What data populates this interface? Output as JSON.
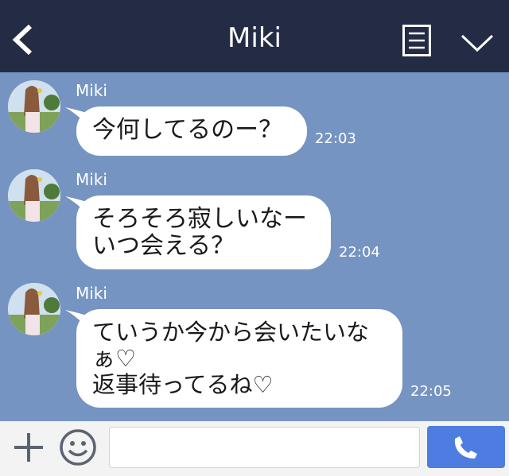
{
  "header": {
    "title": "Miki",
    "back_icon": "chevron-left-icon",
    "menu_icon": "menu-icon",
    "collapse_icon": "chevron-down-icon"
  },
  "messages": [
    {
      "sender": "Miki",
      "lines": [
        "今何してるのー？"
      ],
      "time": "22:03"
    },
    {
      "sender": "Miki",
      "lines": [
        "そろそろ寂しいなー",
        "いつ会える？"
      ],
      "time": "22:04"
    },
    {
      "sender": "Miki",
      "lines": [
        "ていうか今から会いたいな",
        "ぁ♡",
        "返事待ってるね♡"
      ],
      "time": "22:05"
    }
  ],
  "footer": {
    "plus_icon": "plus-icon",
    "emoji_icon": "smiley-icon",
    "input_value": "",
    "send_icon": "phone-icon"
  },
  "colors": {
    "header": "#232b45",
    "chat_background": "#7594c1",
    "bubble": "#ffffff",
    "send_button": "#4d7de0"
  }
}
